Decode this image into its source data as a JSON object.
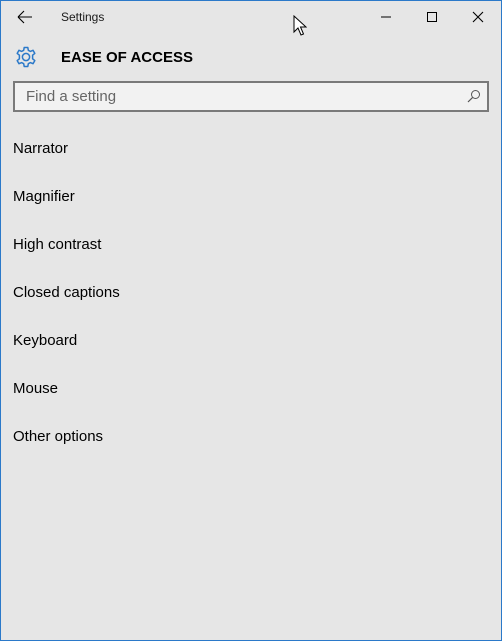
{
  "window": {
    "title": "Settings"
  },
  "header": {
    "title": "EASE OF ACCESS",
    "icon": "gear-icon",
    "accent_color": "#2b79c9"
  },
  "search": {
    "placeholder": "Find a setting",
    "value": "",
    "icon": "search-icon"
  },
  "menu": {
    "items": [
      {
        "label": "Narrator"
      },
      {
        "label": "Magnifier"
      },
      {
        "label": "High contrast"
      },
      {
        "label": "Closed captions"
      },
      {
        "label": "Keyboard"
      },
      {
        "label": "Mouse"
      },
      {
        "label": "Other options"
      }
    ]
  },
  "theme": {
    "background": "#e6e6e6",
    "border": "#2b79c9",
    "search_border": "#7a7a7a"
  }
}
